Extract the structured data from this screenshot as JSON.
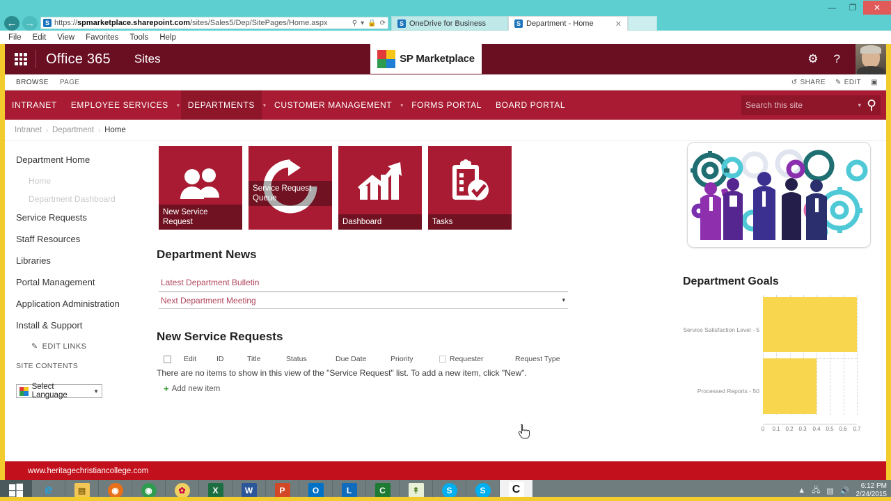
{
  "window": {
    "minimize_label": "—",
    "maximize_label": "❐",
    "close_label": "✕"
  },
  "browser": {
    "back_label": "←",
    "forward_label": "→",
    "url_prefix": "https://",
    "url_domain": "spmarketplace.sharepoint.com",
    "url_path": "/sites/Sales5/Dep/SitePages/Home.aspx",
    "url_favicon": "S",
    "search_icon": "search-icon",
    "lock_icon": "🔒",
    "refresh_icon": "⟳",
    "caret": "▾",
    "tabs": [
      {
        "label": "OneDrive for Business",
        "favicon": "S",
        "active": false
      },
      {
        "label": "Department - Home",
        "favicon": "S",
        "active": true,
        "close_label": "✕"
      }
    ],
    "menu": [
      "File",
      "Edit",
      "View",
      "Favorites",
      "Tools",
      "Help"
    ]
  },
  "suitebar": {
    "brand": "Office 365",
    "sites_label": "Sites",
    "logo_text": "SP Marketplace",
    "settings_icon": "⚙",
    "help_icon": "?"
  },
  "ribbon": {
    "tabs": [
      "BROWSE",
      "PAGE"
    ],
    "share_label": "SHARE",
    "edit_label": "EDIT",
    "share_icon": "↺",
    "edit_icon": "✎",
    "focus_icon": "▣"
  },
  "topnav": {
    "items": [
      {
        "label": "INTRANET",
        "caret": false,
        "selected": false
      },
      {
        "label": "EMPLOYEE SERVICES",
        "caret": true,
        "selected": false
      },
      {
        "label": "DEPARTMENTS",
        "caret": true,
        "selected": true
      },
      {
        "label": "CUSTOMER MANAGEMENT",
        "caret": true,
        "selected": false
      },
      {
        "label": "FORMS PORTAL",
        "caret": false,
        "selected": false
      },
      {
        "label": "BOARD PORTAL",
        "caret": false,
        "selected": false
      }
    ],
    "search_placeholder": "Search this site",
    "search_value": "",
    "search_caret": "▾",
    "search_icon": "search-icon"
  },
  "breadcrumb": {
    "items": [
      "Intranet",
      "Department",
      "Home"
    ],
    "separator": "›"
  },
  "sidebar": {
    "items": [
      {
        "label": "Department Home",
        "sub": false
      },
      {
        "label": "Home",
        "sub": true
      },
      {
        "label": "Department Dashboard",
        "sub": true
      },
      {
        "label": "Service Requests",
        "sub": false
      },
      {
        "label": "Staff Resources",
        "sub": false
      },
      {
        "label": "Libraries",
        "sub": false
      },
      {
        "label": "Portal Management",
        "sub": false
      },
      {
        "label": "Application Administration",
        "sub": false
      },
      {
        "label": "Install & Support",
        "sub": false
      }
    ],
    "edit_links_label": "EDIT LINKS",
    "edit_links_icon": "✎",
    "site_contents_label": "SITE CONTENTS",
    "language_label": "Select Language",
    "language_caret": "▼"
  },
  "tiles": [
    {
      "label": "New Service\nRequest",
      "icon": "people-icon",
      "label_position": "bottom"
    },
    {
      "label": "Service Request\nQueue",
      "icon": "refresh-arrow-icon",
      "label_position": "middle"
    },
    {
      "label": "Dashboard",
      "icon": "bar-chart-arrow-icon",
      "label_position": "bottom"
    },
    {
      "label": "Tasks",
      "icon": "clipboard-check-icon",
      "label_position": "bottom"
    }
  ],
  "news": {
    "heading": "Department News",
    "items": [
      "Latest Department Bulletin",
      "Next Department Meeting"
    ],
    "row_caret": "▾"
  },
  "requests": {
    "heading": "New Service Requests",
    "columns": [
      "Edit",
      "ID",
      "Title",
      "Status",
      "Due Date",
      "Priority",
      "Requester",
      "Request Type"
    ],
    "empty_message": "There are no items to show in this view of the \"Service Request\" list. To add a new item, click \"New\".",
    "add_label": "Add new item",
    "add_icon": "+"
  },
  "goals": {
    "heading": "Department Goals"
  },
  "chart_data": {
    "type": "bar",
    "orientation": "horizontal",
    "title": "Department Goals",
    "categories": [
      "Service Satisfaction Level - 5",
      "Processed Reports - 50"
    ],
    "values": [
      0.7,
      0.4
    ],
    "xlabel": "",
    "ylabel": "",
    "xlim": [
      0,
      0.7
    ],
    "ticks": [
      "0",
      "0.1",
      "0.2",
      "0.3",
      "0.4",
      "0.5",
      "0.6",
      "0.7"
    ],
    "tick_values": [
      0,
      0.1,
      0.2,
      0.3,
      0.4,
      0.5,
      0.6,
      0.7
    ],
    "bar_color": "#f8d64e",
    "grid": true,
    "legend": false
  },
  "hero": {
    "alt": "team-and-gears-illustration"
  },
  "footer": {
    "url": "www.heritagechristiancollege.com"
  },
  "taskbar": {
    "start_icon": "windows-icon",
    "items": [
      {
        "name": "internet-explorer",
        "glyph": "e",
        "color": "#1f9fdb"
      },
      {
        "name": "file-explorer",
        "glyph": "▤",
        "color": "#f5c851"
      },
      {
        "name": "firefox",
        "glyph": "🦊",
        "color": "#e8701a"
      },
      {
        "name": "chrome",
        "glyph": "◉",
        "color": "#2e9b4f"
      },
      {
        "name": "paint",
        "glyph": "✿",
        "color": "#f0d060"
      },
      {
        "name": "excel",
        "glyph": "X",
        "color": "#1d6f42"
      },
      {
        "name": "word",
        "glyph": "W",
        "color": "#2b579a"
      },
      {
        "name": "powerpoint",
        "glyph": "P",
        "color": "#d24726"
      },
      {
        "name": "outlook",
        "glyph": "O",
        "color": "#0072c6"
      },
      {
        "name": "lync",
        "glyph": "L",
        "color": "#0f6cbd"
      },
      {
        "name": "camtasia",
        "glyph": "C",
        "color": "#1d7a33"
      },
      {
        "name": "snagit",
        "glyph": "↟",
        "color": "#8bc34a"
      },
      {
        "name": "skype",
        "glyph": "S",
        "color": "#00aff0"
      },
      {
        "name": "skype-business",
        "glyph": "S",
        "color": "#00aff0"
      },
      {
        "name": "camtasia-active",
        "glyph": "C",
        "color": "#ffffff"
      }
    ],
    "tray_icons": [
      "▲",
      "🖧",
      "📶",
      "🔊"
    ],
    "time": "6:12 PM",
    "date": "2/24/2015"
  },
  "colors": {
    "brand_red": "#a81b32",
    "suite_dark": "#6a0f22",
    "nav_selected": "#8f1529",
    "chart_yellow": "#f8d64e",
    "frame_yellow": "#f2cb2d",
    "browser_teal": "#5ecfd0",
    "footer_red": "#c2101c"
  }
}
